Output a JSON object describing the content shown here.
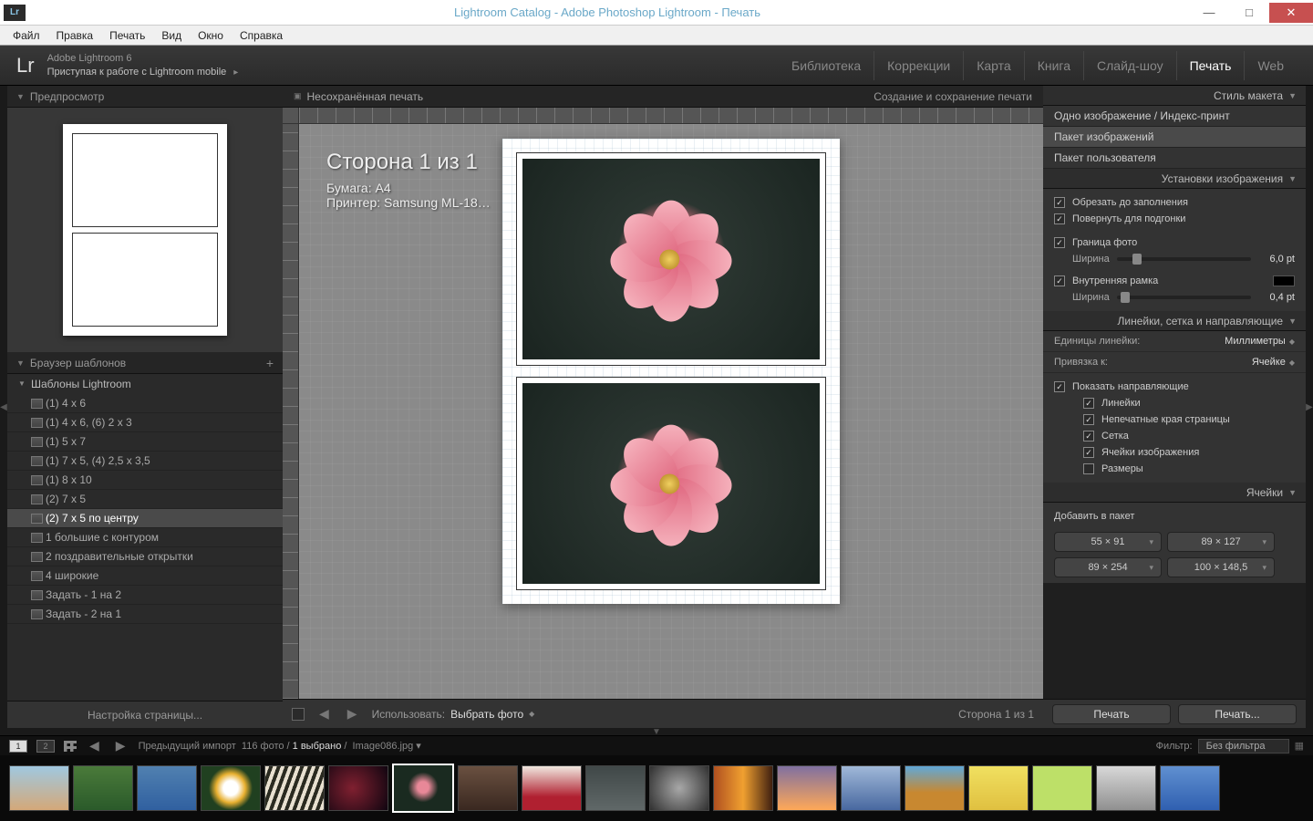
{
  "titlebar": {
    "title": "Lightroom Catalog - Adobe Photoshop Lightroom - Печать"
  },
  "menubar": [
    "Файл",
    "Правка",
    "Печать",
    "Вид",
    "Окно",
    "Справка"
  ],
  "identity": {
    "logo": "Lr",
    "product": "Adobe Lightroom 6",
    "mobile": "Приступая к работе с Lightroom mobile"
  },
  "modules": [
    "Библиотека",
    "Коррекции",
    "Карта",
    "Книга",
    "Слайд-шоу",
    "Печать",
    "Web"
  ],
  "active_module": "Печать",
  "left": {
    "preview_hdr": "Предпросмотр",
    "templates_hdr": "Браузер шаблонов",
    "folder": "Шаблоны Lightroom",
    "items": [
      "(1) 4 x 6",
      "(1) 4 x 6, (6) 2 x 3",
      "(1) 5 x 7",
      "(1) 7 x 5, (4) 2,5 x 3,5",
      "(1) 8 x 10",
      "(2) 7 x 5",
      "(2) 7 x 5 по центру",
      "1 большие с контуром",
      "2 поздравительные открытки",
      "4 широкие",
      "Задать - 1 на 2",
      "Задать - 2 на 1"
    ],
    "selected": "(2) 7 x 5 по центру",
    "page_setup": "Настройка страницы..."
  },
  "center": {
    "hdr_left": "Несохранённая печать",
    "hdr_right": "Создание и сохранение печати",
    "page_title": "Сторона 1 из 1",
    "paper": "Бумага:  A4",
    "printer": "Принтер:  Samsung ML-18…",
    "use_label": "Использовать:",
    "use_value": "Выбрать фото",
    "page_info": "Сторона 1 из 1"
  },
  "right": {
    "layout_hdr": "Стиль макета",
    "layout_opts": [
      "Одно изображение / Индекс-принт",
      "Пакет изображений",
      "Пакет пользователя"
    ],
    "layout_sel": "Пакет изображений",
    "image_hdr": "Установки изображения",
    "crop_fill": "Обрезать до заполнения",
    "rotate_fit": "Повернуть для подгонки",
    "photo_border": "Граница фото",
    "width_lbl": "Ширина",
    "width_val": "6,0",
    "pt": "pt",
    "inner_frame": "Внутренняя рамка",
    "inner_val": "0,4",
    "guides_hdr": "Линейки, сетка и направляющие",
    "ruler_units_lbl": "Единицы линейки:",
    "ruler_units_val": "Миллиметры",
    "snap_lbl": "Привязка к:",
    "snap_val": "Ячейке",
    "show_guides": "Показать направляющие",
    "g_rulers": "Линейки",
    "g_bleed": "Непечатные края страницы",
    "g_grid": "Сетка",
    "g_cells": "Ячейки изображения",
    "g_dims": "Размеры",
    "cells_hdr": "Ячейки",
    "add_pkg": "Добавить в пакет",
    "cell_btns": [
      "55 × 91",
      "89 × 127",
      "89 × 254",
      "100 × 148,5"
    ],
    "print": "Печать",
    "print_dots": "Печать..."
  },
  "filmstrip": {
    "info_pre": "Предыдущий импорт",
    "count": "116 фото",
    "selected": "1 выбрано",
    "file": "Image086.jpg",
    "filter_lbl": "Фильтр:",
    "filter_val": "Без фильтра"
  },
  "thumbs": [
    "linear-gradient(#a0c8e0,#d4a878)",
    "linear-gradient(#4a7a3a,#2a5a2a)",
    "linear-gradient(#5080b0,#3060a0)",
    "radial-gradient(circle,#fff 20%,#e8b030 40%,#204020 60%)",
    "repeating-linear-gradient(110deg,#e8e0d0 0 4px,#2a2a20 4px 8px)",
    "radial-gradient(circle at 40% 50%,#802030,#100510)",
    "radial-gradient(circle at 50% 48%,#e88898 15%,#1a2a20 40%)",
    "linear-gradient(#6a5040,#3a2820)",
    "linear-gradient(#f0e8e0,#b02030 70%)",
    "linear-gradient(#404848,#606868)",
    "radial-gradient(circle,#a8a8a8,#303030)",
    "linear-gradient(90deg,#b05020,#f0a030,#402010)",
    "linear-gradient(#8070a0,#ffa858)",
    "linear-gradient(#a0b8d8,#4868a0)",
    "linear-gradient(#60a8d8,#c88830 60%)",
    "linear-gradient(#f0e060,#e0c040)",
    "#bde068",
    "linear-gradient(#d8d8d8,#909090)",
    "linear-gradient(#6090d0,#3060b0)"
  ],
  "thumb_sel": 6
}
